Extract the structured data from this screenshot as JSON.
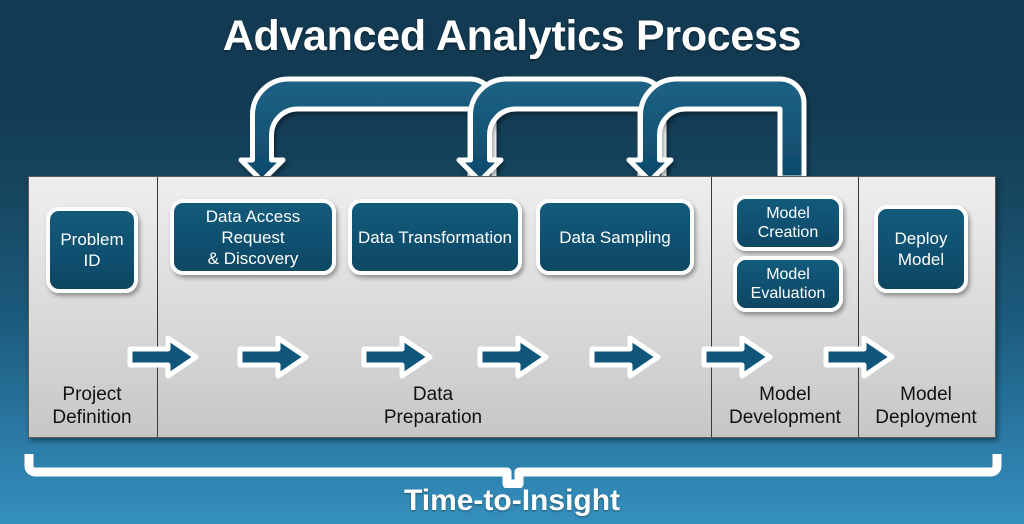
{
  "title": "Advanced Analytics Process",
  "caption": "Time-to-Insight",
  "colors": {
    "background_top": "#123a52",
    "background_bottom": "#3590bd",
    "band_fill": "#e0e0e0",
    "box_fill": "#0f5070",
    "box_border": "#ffffff",
    "arrow_fill": "#10567a",
    "text_light": "#ffffff",
    "text_dark": "#111111"
  },
  "phases": [
    {
      "label": "Project\nDefinition",
      "line1": "Project",
      "line2": "Definition"
    },
    {
      "label": "Data\nPreparation",
      "line1": "Data",
      "line2": "Preparation"
    },
    {
      "label": "Model\nDevelopment",
      "line1": "Model",
      "line2": "Development"
    },
    {
      "label": "Model\nDeployment",
      "line1": "Model",
      "line2": "Deployment"
    }
  ],
  "steps": [
    {
      "id": "problem-id",
      "line1": "Problem",
      "line2": "ID",
      "phase": "Project Definition"
    },
    {
      "id": "data-access-request-discovery",
      "line1": "Data Access Request",
      "line2": "&  Discovery",
      "phase": "Data Preparation"
    },
    {
      "id": "data-transformation",
      "line1": "Data Transformation",
      "line2": "",
      "phase": "Data Preparation"
    },
    {
      "id": "data-sampling",
      "line1": "Data Sampling",
      "line2": "",
      "phase": "Data Preparation"
    },
    {
      "id": "model-creation",
      "line1": "Model",
      "line2": "Creation",
      "phase": "Model Development"
    },
    {
      "id": "model-evaluation",
      "line1": "Model",
      "line2": "Evaluation",
      "phase": "Model Development"
    },
    {
      "id": "deploy-model",
      "line1": "Deploy",
      "line2": "Model",
      "phase": "Model Deployment"
    }
  ],
  "process_arrow_count": 7,
  "feedback_arcs": [
    {
      "id": "feedback-arc-1",
      "from": "data-transformation",
      "to": "data-access-request-discovery"
    },
    {
      "id": "feedback-arc-2",
      "from": "data-sampling",
      "to": "data-transformation"
    },
    {
      "id": "feedback-arc-3",
      "from": "model-creation",
      "to": "data-sampling"
    }
  ],
  "icons": {
    "process_arrow": "right-arrow-icon",
    "feedback_arrow": "curved-feedback-arrow-icon",
    "bracket": "span-bracket-icon"
  }
}
